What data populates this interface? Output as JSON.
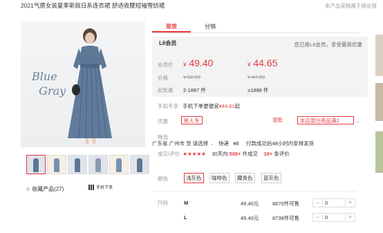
{
  "header": {
    "title": "2021气质女装夏季新款日系连衣裙 舒适收腰短袖雪纺裙",
    "notice": "本产品采购属于商业贸"
  },
  "gallery": {
    "script_text": "Blue\nGray",
    "thumbs": 7,
    "favorite_label": "收藏产品(27)",
    "qr_label": "手机下单"
  },
  "tabs": [
    {
      "label": "现货",
      "active": true
    },
    {
      "label": "分销",
      "active": false
    }
  ],
  "pricing": {
    "vip_title": "L6会员",
    "vip_note": "您已是L6会员，享受最高优惠",
    "member_price_label": "会员价",
    "member_price_1": "49.40",
    "member_price_2": "44.65",
    "price_label": "价格",
    "price_1": "¥ 52.00",
    "price_2": "¥ 47.00",
    "moq_label": "起批量",
    "moq_1": "2-1887 件",
    "moq_2": "≥1888 件",
    "currency": "¥"
  },
  "mobile": {
    "label": "手机专享",
    "text_pre": "手机下单更便宜",
    "amount": "¥44.61",
    "text_post": "起"
  },
  "promo": {
    "label": "优惠",
    "tag1": "新人专",
    "tag2": "混批",
    "tag3": "本店部分商品满2"
  },
  "shipping": {
    "label": "物流",
    "from": "广东省 广州市",
    "to_label": "至",
    "to": "请选择",
    "method": "快递",
    "fee": "¥8",
    "promise": "付款成功后48小时内安排发货"
  },
  "deals": {
    "label": "成交\\评价",
    "stars": "★★★★★",
    "deals_pre": "30天内",
    "deals_num": "500+",
    "deals_post": "件成交",
    "reviews_num": "10+",
    "reviews_post": "条评价"
  },
  "colors": {
    "label": "颜色",
    "options": [
      "浅灰色",
      "咖啡色",
      "藏青色",
      "蓝灰色"
    ],
    "selected": "浅灰色"
  },
  "sizes": {
    "label": "尺码",
    "rows": [
      {
        "name": "M",
        "price": "49.40元",
        "stock": "8670件可售",
        "qty": "0"
      },
      {
        "name": "L",
        "price": "49.40元",
        "stock": "8738件可售",
        "qty": "0"
      }
    ]
  },
  "colors_hex": {
    "accent": "#e4393c",
    "price_bg": "#f3f3f3"
  }
}
